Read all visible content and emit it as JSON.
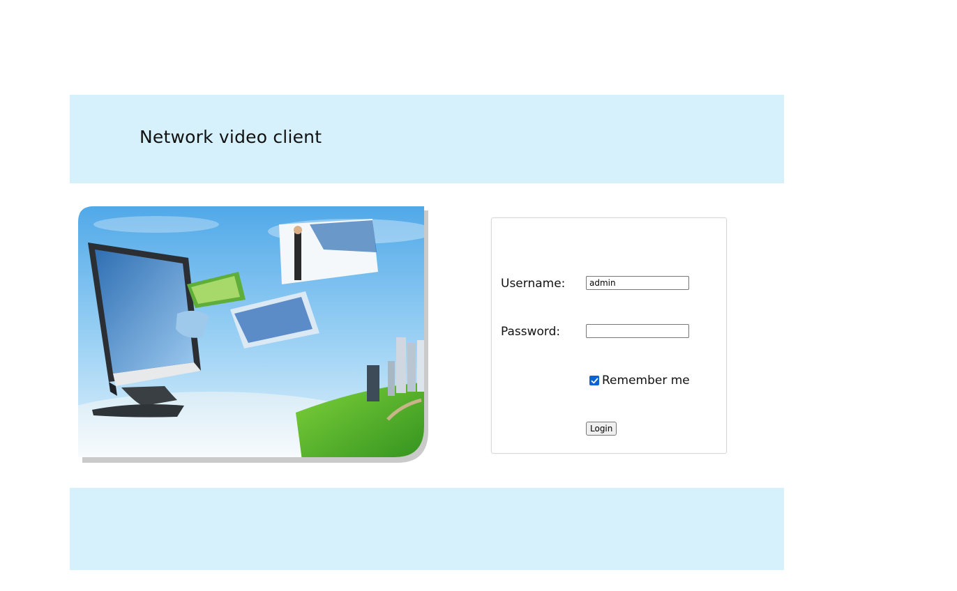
{
  "header": {
    "title": "Network video client"
  },
  "login": {
    "username_label": "Username:",
    "username_value": "admin",
    "password_label": "Password:",
    "password_value": "",
    "remember_label": "Remember me",
    "remember_checked": true,
    "login_label": "Login"
  },
  "colors": {
    "band": "#d6f1fc",
    "checkbox_accent": "#0b63d6"
  },
  "icons": {
    "hero": "monitor-with-flying-photos-illustration",
    "check": "checkmark-icon"
  }
}
